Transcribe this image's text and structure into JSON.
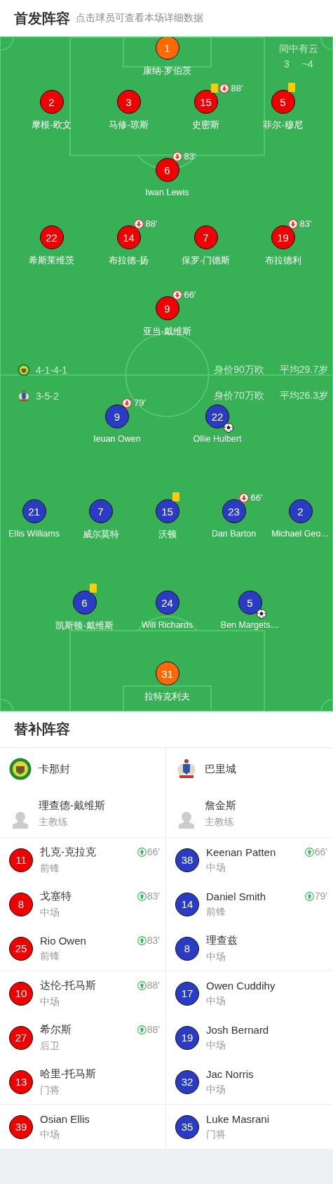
{
  "header": {
    "title": "首发阵容",
    "hint": "点击球员可查看本场详细数据"
  },
  "pitch": {
    "weather": {
      "condition": "间中有云",
      "low": "3",
      "high": "~4"
    },
    "teams": [
      {
        "color": "#f00000",
        "formation": "4-1-4-1",
        "value": "身价90万欧",
        "avg_age": "平均29.7岁",
        "lines": [
          {
            "players": [
              {
                "number": "1",
                "name": "康纳-罗伯茨",
                "kind": "keeper",
                "yellow_card": false,
                "goal": false
              }
            ]
          },
          {
            "players": [
              {
                "number": "2",
                "name": "摩根-欧文",
                "kind": "outfield",
                "yellow_card": false,
                "goal": false
              },
              {
                "number": "3",
                "name": "马修-琼斯",
                "kind": "outfield",
                "yellow_card": false,
                "goal": false
              },
              {
                "number": "15",
                "name": "史密斯",
                "kind": "outfield",
                "yellow_card": true,
                "sub_off": "88'",
                "goal": false
              },
              {
                "number": "5",
                "name": "菲尔-穆尼",
                "kind": "outfield",
                "yellow_card": true,
                "goal": false
              }
            ]
          },
          {
            "players": [
              {
                "number": "6",
                "name": "Iwan Lewis",
                "kind": "outfield",
                "yellow_card": false,
                "sub_off": "83'",
                "goal": false
              }
            ]
          },
          {
            "players": [
              {
                "number": "22",
                "name": "希斯莱维茨",
                "kind": "outfield",
                "yellow_card": false,
                "goal": false
              },
              {
                "number": "14",
                "name": "布拉德-扬",
                "kind": "outfield",
                "yellow_card": false,
                "sub_off": "88'",
                "goal": false
              },
              {
                "number": "7",
                "name": "保罗-门德斯",
                "kind": "outfield",
                "yellow_card": false,
                "goal": false
              },
              {
                "number": "19",
                "name": "布拉德利",
                "kind": "outfield",
                "yellow_card": false,
                "sub_off": "83'",
                "goal": false
              }
            ]
          },
          {
            "players": [
              {
                "number": "9",
                "name": "亚当-戴维斯",
                "kind": "outfield",
                "yellow_card": false,
                "sub_off": "66'",
                "goal": false
              }
            ]
          }
        ]
      },
      {
        "color": "#2a3cc4",
        "formation": "3-5-2",
        "value": "身价70万欧",
        "avg_age": "平均26.3岁",
        "lines": [
          {
            "players": [
              {
                "number": "9",
                "name": "Ieuan Owen",
                "kind": "outfield",
                "yellow_card": false,
                "sub_off": "79'",
                "goal": false
              },
              {
                "number": "22",
                "name": "Ollie Hulbert",
                "kind": "outfield",
                "yellow_card": false,
                "goal": true
              }
            ]
          },
          {
            "players": [
              {
                "number": "21",
                "name": "Ellis Williams",
                "kind": "outfield",
                "yellow_card": false,
                "goal": false
              },
              {
                "number": "7",
                "name": "威尔莫特",
                "kind": "outfield",
                "yellow_card": false,
                "goal": false
              },
              {
                "number": "15",
                "name": "沃顿",
                "kind": "outfield",
                "yellow_card": true,
                "goal": false
              },
              {
                "number": "23",
                "name": "Dan Barton",
                "kind": "outfield",
                "yellow_card": false,
                "sub_off": "66'",
                "goal": false
              },
              {
                "number": "2",
                "name": "Michael Geo…",
                "kind": "outfield",
                "yellow_card": false,
                "goal": false
              }
            ]
          },
          {
            "players": [
              {
                "number": "6",
                "name": "凯斯顿-戴维斯",
                "kind": "outfield",
                "yellow_card": true,
                "goal": false
              },
              {
                "number": "24",
                "name": "Will Richards",
                "kind": "outfield",
                "yellow_card": false,
                "goal": false
              },
              {
                "number": "5",
                "name": "Ben Margets…",
                "kind": "outfield",
                "yellow_card": false,
                "goal": true
              }
            ]
          },
          {
            "players": [
              {
                "number": "31",
                "name": "拉特克利夫",
                "kind": "keeper",
                "yellow_card": false,
                "goal": false
              }
            ]
          }
        ]
      }
    ]
  },
  "subs": {
    "title": "替补阵容",
    "teams": [
      {
        "name": "卡那封",
        "coach": {
          "name": "理查德-戴维斯",
          "role": "主教练"
        },
        "players": [
          {
            "number": "11",
            "name": "扎克-克拉克",
            "position": "前锋",
            "sub_on": "66'"
          },
          {
            "number": "8",
            "name": "戈塞特",
            "position": "中场",
            "sub_on": "83'"
          },
          {
            "number": "25",
            "name": "Rio Owen",
            "position": "前锋",
            "sub_on": "83'"
          },
          {
            "number": "10",
            "name": "达伦-托马斯",
            "position": "中场",
            "sub_on": "88'"
          },
          {
            "number": "27",
            "name": "希尔斯",
            "position": "后卫",
            "sub_on": "88'"
          },
          {
            "number": "13",
            "name": "哈里-托马斯",
            "position": "门将"
          },
          {
            "number": "39",
            "name": "Osian Ellis",
            "position": "中场"
          }
        ]
      },
      {
        "name": "巴里城",
        "coach": {
          "name": "詹金斯",
          "role": "主教练"
        },
        "players": [
          {
            "number": "38",
            "name": "Keenan Patten",
            "position": "中场",
            "sub_on": "66'"
          },
          {
            "number": "14",
            "name": "Daniel Smith",
            "position": "前锋",
            "sub_on": "79'"
          },
          {
            "number": "8",
            "name": "理查兹",
            "position": "中场"
          },
          {
            "number": "17",
            "name": "Owen Cuddihy",
            "position": "中场"
          },
          {
            "number": "19",
            "name": "Josh Bernard",
            "position": "中场"
          },
          {
            "number": "32",
            "name": "Jac Norris",
            "position": "中场"
          },
          {
            "number": "35",
            "name": "Luke Masrani",
            "position": "门将"
          }
        ]
      }
    ]
  }
}
